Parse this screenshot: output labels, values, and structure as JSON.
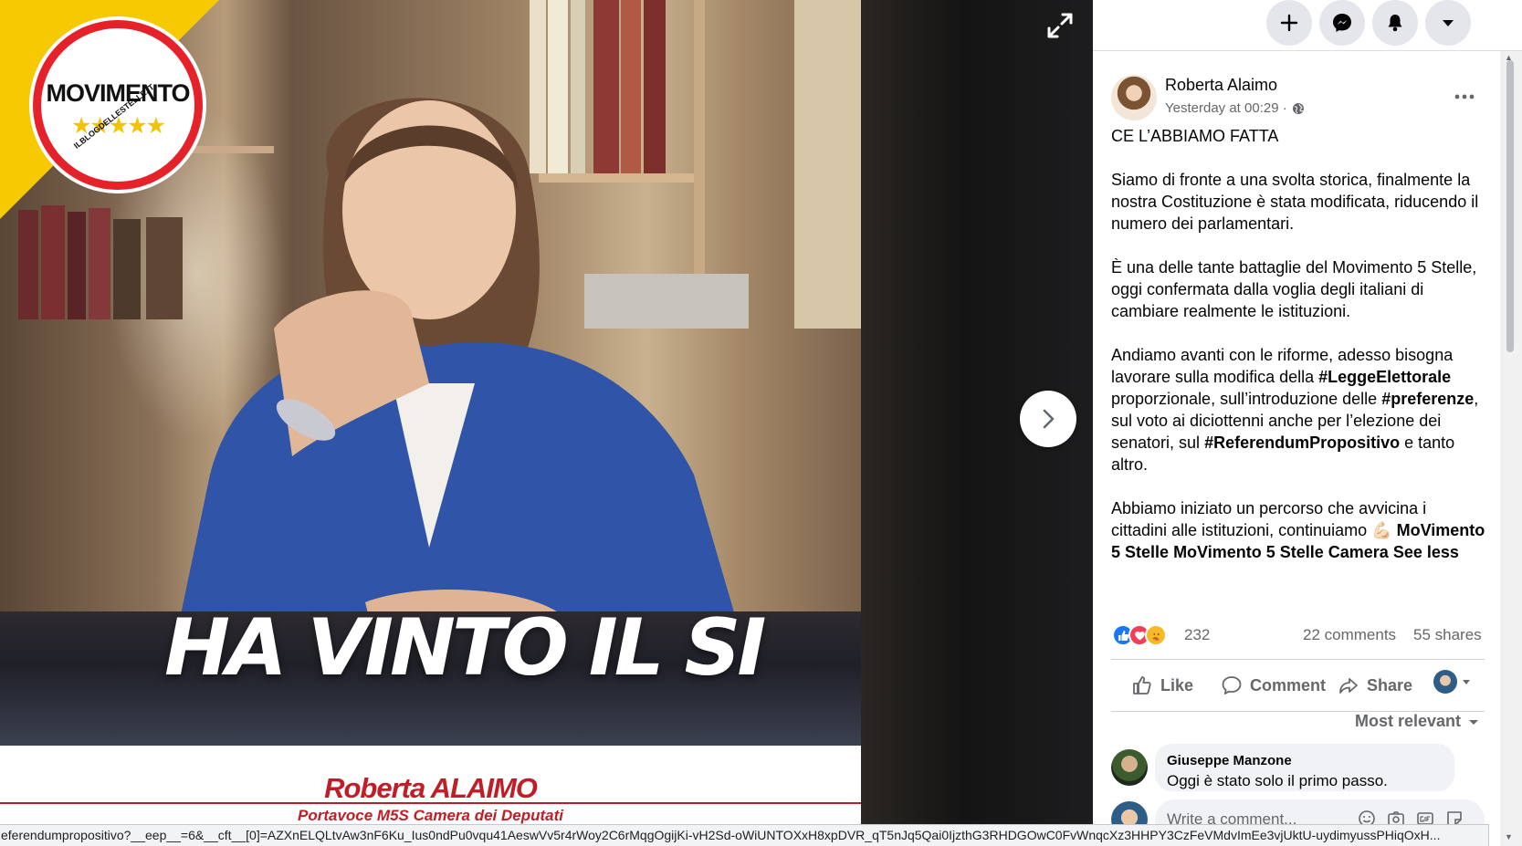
{
  "viewer": {
    "image": {
      "logo_text": "MOVIMENTO",
      "logo_stars": "★★★★★",
      "logo_arc_text": "ILBLOGDELLESTELLE.IT",
      "headline": "HA VINTO IL SI",
      "caption_name": "Roberta ALAIMO",
      "caption_role": "Portavoce M5S Camera dei Deputati"
    },
    "icons": {
      "expand": "expand-icon",
      "next": "chevron-right-icon"
    }
  },
  "topbar": {
    "buttons": [
      "plus-icon",
      "messenger-icon",
      "bell-icon",
      "caret-down-icon"
    ]
  },
  "post": {
    "author": "Roberta Alaimo",
    "time": "Yesterday at 00:29 ·",
    "audience_icon": "globe-icon",
    "paragraphs": {
      "p1": "CE L’ABBIAMO FATTA",
      "p2": "Siamo di fronte a una svolta storica, finalmente la nostra Costituzione è stata modificata, riducendo il numero dei parlamentari.",
      "p3": "È una delle tante battaglie del Movimento 5 Stelle, oggi confermata dalla voglia degli italiani di cambiare realmente le istituzioni.",
      "p4_a": "Andiamo avanti con le riforme, adesso bisogna lavorare sulla modifica della ",
      "p4_tag1": "#LeggeElettorale",
      "p4_b": " proporzionale, sull’introduzione delle ",
      "p4_tag2": "#preferenze",
      "p4_c": ", sul voto ai diciottenni anche per l’elezione dei senatori, sul ",
      "p4_tag3": "#ReferendumPropositivo",
      "p4_d": " e tanto altro.",
      "p5_a": "Abbiamo iniziato un percorso che avvicina i cittadini alle istituzioni, continuiamo ",
      "p5_emoji": "💪🏻",
      "p5_link1": "MoVimento 5 Stelle",
      "p5_link2": "MoVimento 5 Stelle Camera",
      "see_less": "See less"
    },
    "reactions": {
      "icons": [
        "like-icon",
        "love-icon",
        "care-icon"
      ],
      "count": "232",
      "comments": "22 comments",
      "shares": "55 shares"
    },
    "actions": {
      "like": "Like",
      "comment": "Comment",
      "share": "Share"
    },
    "sort_label": "Most relevant"
  },
  "comment": {
    "author": "Giuseppe Manzone",
    "text": "Oggi è stato solo il primo passo."
  },
  "write_comment": {
    "placeholder": "Write a comment...",
    "icons": [
      "emoji-icon",
      "camera-icon",
      "gif-icon",
      "sticker-icon"
    ]
  },
  "status_url": "eferendumpropositivo?__eep__=6&__cft__[0]=AZXnELQLtvAw3nF6Ku_Ius0ndPu0vqu41AeswVv5r4rWoy2C6rMqgOgijKi-vH2Sd-oWiUNTOXxH8xpDVR_qT5nJq5Qai0IjzthG3RHDGOwC0FvWnqcXz3HHPY3CzFeVMdvImEe3vjUktU-uydimyussPHiqOxH..."
}
